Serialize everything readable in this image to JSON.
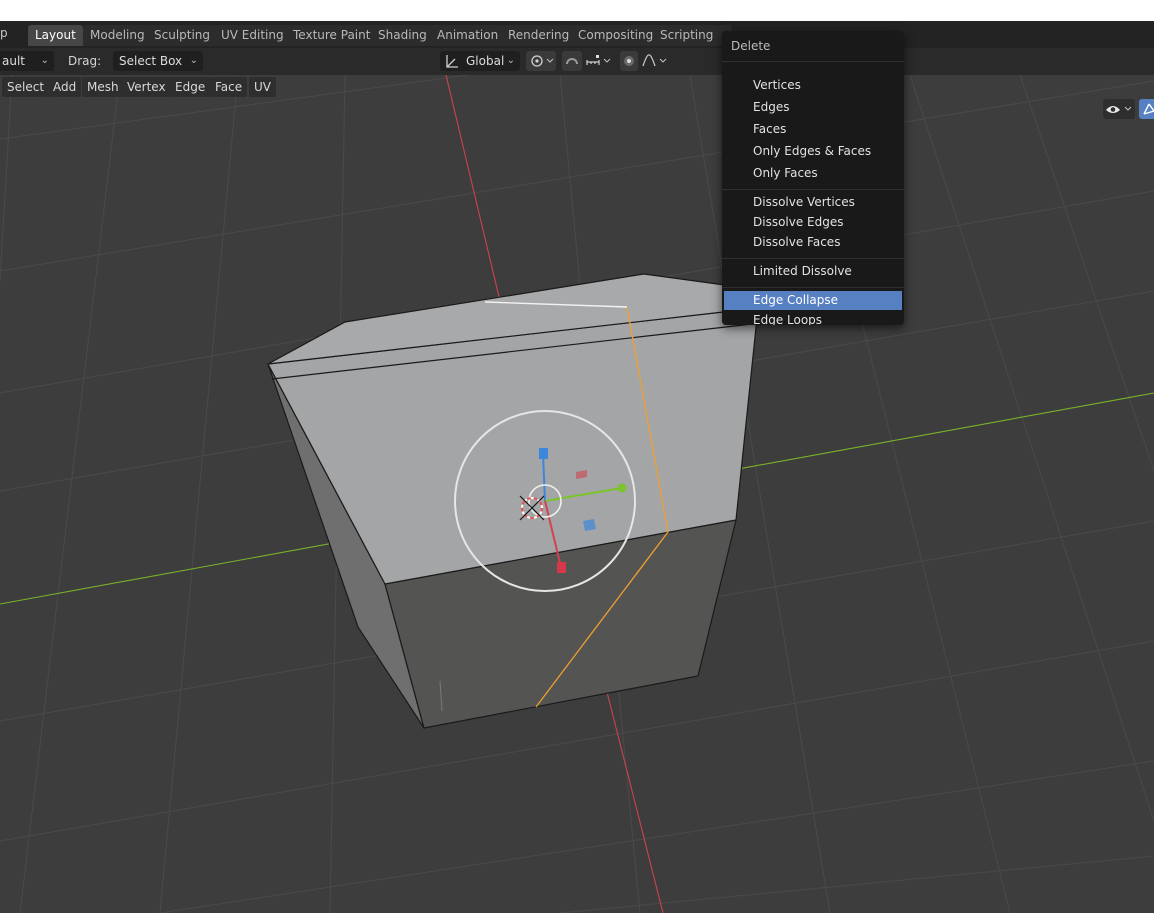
{
  "workspace_tabs": [
    {
      "label": "Layout",
      "active": true
    },
    {
      "label": "Modeling",
      "active": false
    },
    {
      "label": "Sculpting",
      "active": false
    },
    {
      "label": "UV Editing",
      "active": false
    },
    {
      "label": "Texture Paint",
      "active": false
    },
    {
      "label": "Shading",
      "active": false
    },
    {
      "label": "Animation",
      "active": false
    },
    {
      "label": "Rendering",
      "active": false
    },
    {
      "label": "Compositing",
      "active": false
    },
    {
      "label": "Scripting",
      "active": false
    }
  ],
  "toolbar": {
    "mode_value": "ault",
    "drag_label": "Drag:",
    "drag_value": "Select Box",
    "orientation_value": "Global"
  },
  "header_menu": [
    "Select",
    "Add",
    "Mesh",
    "Vertex",
    "Edge",
    "Face",
    "UV"
  ],
  "delete_menu": {
    "title": "Delete",
    "groups": [
      [
        "Vertices",
        "Edges",
        "Faces",
        "Only Edges & Faces",
        "Only Faces"
      ],
      [
        "Dissolve Vertices",
        "Dissolve Edges",
        "Dissolve Faces"
      ],
      [
        "Limited Dissolve"
      ],
      [
        "Edge Collapse",
        "Edge Loops"
      ]
    ],
    "highlighted": "Edge Collapse"
  },
  "icons": {
    "orientation": "transform-orientation-icon",
    "pivot": "pivot-point-icon",
    "snap": "snap-icon",
    "proportional": "proportional-editing-icon",
    "visibility": "eye-icon",
    "gizmo": "gizmo-toggle-icon"
  },
  "colors": {
    "x_axis": "#c8444e",
    "y_axis": "#7bb22a",
    "z_axis": "#3c87dc",
    "selected_edge": "#f0a030",
    "menu_highlight": "#5680c2",
    "active_tab": "#474747"
  }
}
